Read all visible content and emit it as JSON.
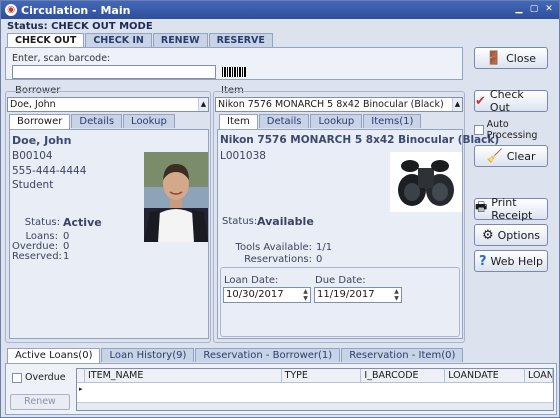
{
  "window": {
    "title": "Circulation - Main",
    "status_line": "Status: CHECK OUT MODE"
  },
  "mode_tabs": [
    {
      "label": "CHECK OUT",
      "active": true
    },
    {
      "label": "CHECK IN",
      "active": false
    },
    {
      "label": "RENEW",
      "active": false
    },
    {
      "label": "RESERVE",
      "active": false
    }
  ],
  "scan": {
    "label": "Enter, scan barcode:",
    "value": ""
  },
  "buttons": {
    "close": "Close",
    "check_out": "Check Out",
    "clear": "Clear",
    "print_receipt": "Print Receipt",
    "options": "Options",
    "web_help": "Web Help",
    "renew": "Renew"
  },
  "auto_processing": {
    "label": "Auto Processing",
    "checked": false
  },
  "borrower": {
    "group_label": "Borrower",
    "selected": "Doe, John",
    "tabs": [
      {
        "label": "Borrower",
        "active": true
      },
      {
        "label": "Details",
        "active": false
      },
      {
        "label": "Lookup",
        "active": false
      }
    ],
    "name": "Doe, John",
    "id": "B00104",
    "phone": "555-444-4444",
    "type": "Student",
    "status_label": "Status:",
    "status_value": "Active",
    "loans_label": "Loans:",
    "loans_value": "0",
    "overdue_label": "Overdue:",
    "overdue_value": "0",
    "reserved_label": "Reserved:",
    "reserved_value": "1"
  },
  "item": {
    "group_label": "Item",
    "selected": "Nikon 7576 MONARCH 5 8x42 Binocular (Black)",
    "tabs": [
      {
        "label": "Item",
        "active": true
      },
      {
        "label": "Details",
        "active": false
      },
      {
        "label": "Lookup",
        "active": false
      },
      {
        "label": "Items(1)",
        "active": false
      }
    ],
    "title": "Nikon 7576 MONARCH 5 8x42 Binocular (Black)",
    "id": "L001038",
    "status_label": "Status:",
    "status_value": "Available",
    "tools_label": "Tools Available:",
    "tools_value": "1/1",
    "reservations_label": "Reservations:",
    "reservations_value": "0",
    "loan_date_label": "Loan Date:",
    "loan_date": "10/30/2017",
    "due_date_label": "Due Date:",
    "due_date": "11/19/2017"
  },
  "bottom_tabs": [
    {
      "label": "Active Loans(0)",
      "active": true
    },
    {
      "label": "Loan History(9)",
      "active": false
    },
    {
      "label": "Reservation - Borrower(1)",
      "active": false
    },
    {
      "label": "Reservation - Item(0)",
      "active": false
    }
  ],
  "overdue_filter": {
    "label": "Overdue",
    "checked": false
  },
  "grid_columns": [
    "ITEM_NAME",
    "TYPE",
    "I_BARCODE",
    "LOANDATE",
    "LOAN"
  ]
}
